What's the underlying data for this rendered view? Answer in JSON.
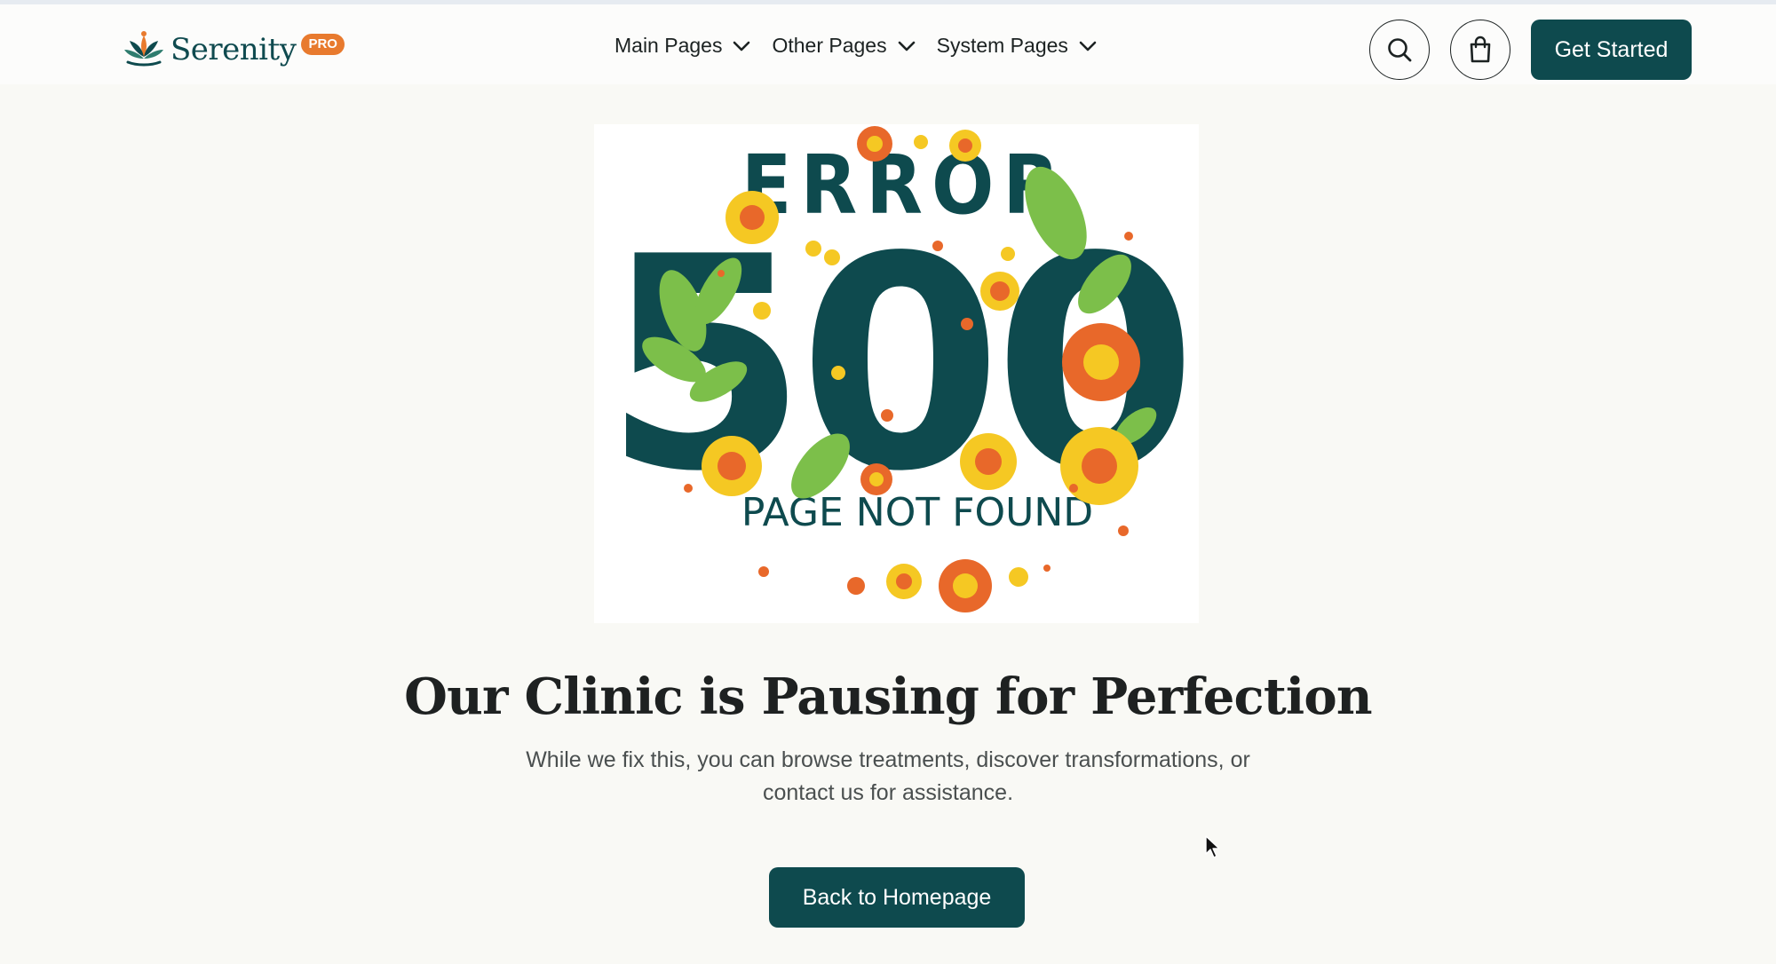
{
  "header": {
    "brand_name": "Serenity",
    "brand_badge": "PRO",
    "nav": [
      {
        "label": "Main Pages",
        "icon": "chevron-down-icon"
      },
      {
        "label": "Other Pages",
        "icon": "chevron-down-icon"
      },
      {
        "label": "System Pages",
        "icon": "chevron-down-icon"
      }
    ],
    "search_icon": "search-icon",
    "cart_icon": "shopping-bag-icon",
    "cta_label": "Get Started"
  },
  "illustration": {
    "title_text": "ERROR",
    "code_text": "500",
    "caption_text": "PAGE NOT FOUND"
  },
  "content": {
    "headline": "Our Clinic is Pausing for Perfection",
    "subtext": "While we fix this, you can browse treatments, discover transformations, or contact us for assistance.",
    "button_label": "Back to Homepage"
  },
  "colors": {
    "primary": "#0e4a4e",
    "accent_orange": "#e87a2e",
    "flower_yellow": "#f5c823",
    "leaf_green": "#7cbf4a",
    "background": "#f9f9f5"
  }
}
